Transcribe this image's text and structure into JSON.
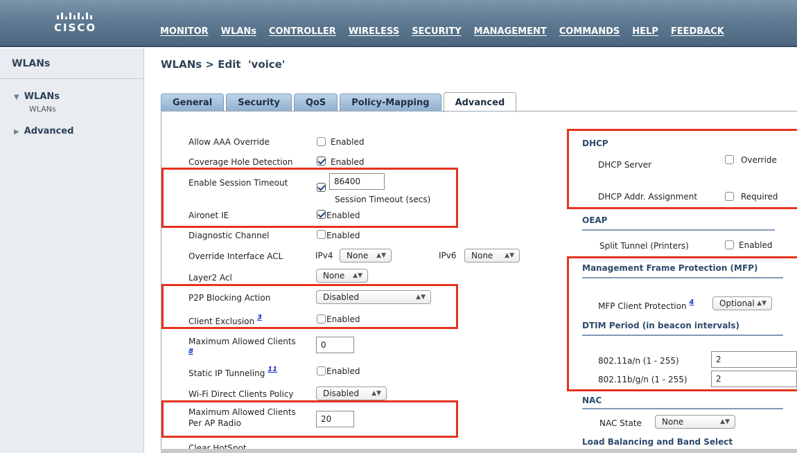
{
  "brand": {
    "logo_text": "CISCO"
  },
  "nav": {
    "items": [
      "MONITOR",
      "WLANs",
      "CONTROLLER",
      "WIRELESS",
      "SECURITY",
      "MANAGEMENT",
      "COMMANDS",
      "HELP",
      "FEEDBACK"
    ]
  },
  "sidebar": {
    "title": "WLANs",
    "items": [
      {
        "label": "WLANs"
      },
      {
        "label": "WLANs"
      },
      {
        "label": "Advanced"
      }
    ]
  },
  "page": {
    "title": "WLANs > Edit  'voice'"
  },
  "tabs": [
    "General",
    "Security",
    "QoS",
    "Policy-Mapping",
    "Advanced"
  ],
  "left": {
    "aaa_override": {
      "label": "Allow AAA Override",
      "value": "Enabled",
      "checked": false
    },
    "coverage_hole": {
      "label": "Coverage Hole Detection",
      "value": "Enabled",
      "checked": true
    },
    "session_timeout": {
      "label": "Enable Session Timeout",
      "checked": true,
      "value": "86400",
      "unit": "Session Timeout (secs)"
    },
    "aironet_ie": {
      "label": "Aironet IE",
      "value": "Enabled",
      "checked": true
    },
    "diag_channel": {
      "label": "Diagnostic Channel",
      "value": "Enabled",
      "checked": false
    },
    "override_acl": {
      "label": "Override Interface ACL",
      "ipv4_label": "IPv4",
      "ipv4_value": "None",
      "ipv6_label": "IPv6",
      "ipv6_value": "None"
    },
    "layer2_acl": {
      "label": "Layer2 Acl",
      "value": "None"
    },
    "p2p": {
      "label": "P2P Blocking Action",
      "value": "Disabled"
    },
    "client_exclusion": {
      "label": "Client Exclusion",
      "footnote": "3",
      "value": "Enabled",
      "checked": false
    },
    "max_clients": {
      "label": "Maximum Allowed Clients",
      "footnote": "8",
      "value": "0"
    },
    "static_ip": {
      "label": "Static IP Tunneling",
      "footnote": "11",
      "value": "Enabled",
      "checked": false
    },
    "wifi_direct": {
      "label": "Wi-Fi Direct Clients Policy",
      "value": "Disabled"
    },
    "max_per_radio": {
      "label1": "Maximum Allowed Clients",
      "label2": "Per AP Radio",
      "value": "20"
    },
    "clear_hotspot": {
      "label": "Clear HotSpot"
    }
  },
  "right": {
    "dhcp": {
      "title": "DHCP",
      "server_label": "DHCP Server",
      "server_value": "Override",
      "server_checked": false,
      "assign_label": "DHCP Addr. Assignment",
      "assign_value": "Required",
      "assign_checked": false
    },
    "oeap": {
      "title": "OEAP",
      "split_label": "Split Tunnel (Printers)",
      "split_value": "Enabled",
      "split_checked": false
    },
    "mfp": {
      "title": "Management Frame Protection (MFP)",
      "client_label": "MFP Client Protection",
      "footnote": "4",
      "client_value": "Optional"
    },
    "dtim": {
      "title": "DTIM Period (in beacon intervals)",
      "a_label": "802.11a/n (1 - 255)",
      "a_value": "2",
      "b_label": "802.11b/g/n (1 - 255)",
      "b_value": "2"
    },
    "nac": {
      "title": "NAC",
      "state_label": "NAC State",
      "state_value": "None"
    },
    "lb": {
      "title": "Load Balancing and Band Select"
    }
  },
  "colors": {
    "highlight": "#e5321e",
    "header": "#5f7a92",
    "section_title": "#2d4a6b"
  }
}
